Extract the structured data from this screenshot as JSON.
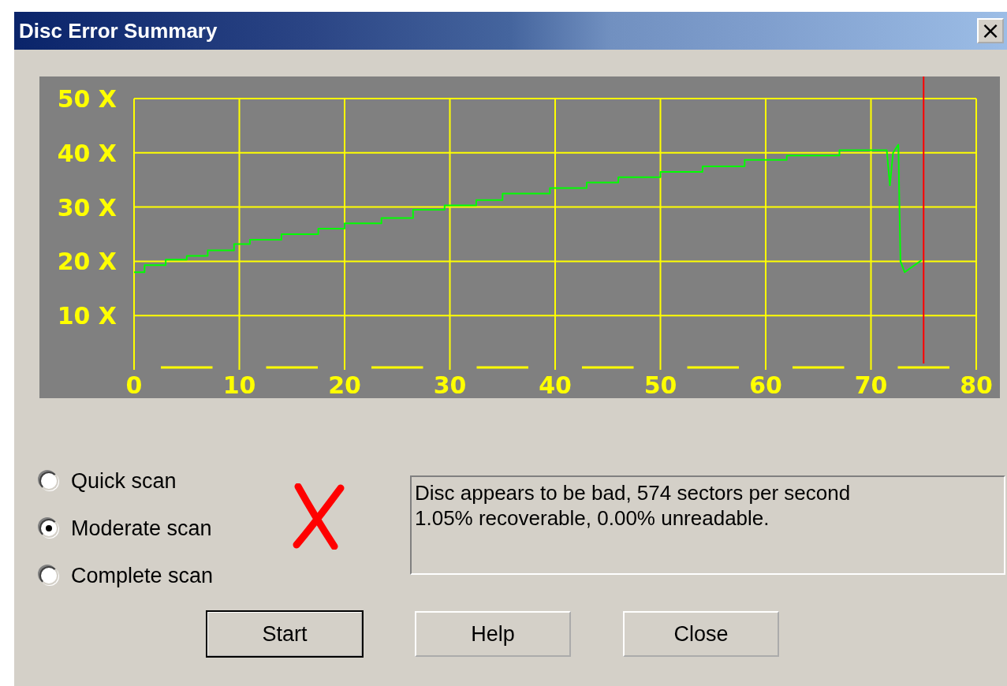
{
  "window": {
    "title": "Disc Error Summary",
    "close_label": "×"
  },
  "chart": {
    "chart_data": {
      "type": "line",
      "x": [
        0,
        1,
        1,
        3,
        3,
        5,
        5,
        7,
        7,
        9.5,
        9.5,
        11,
        11,
        14,
        14,
        17.5,
        17.5,
        20,
        20,
        23.5,
        23.5,
        26.5,
        26.5,
        29.5,
        29.5,
        32.5,
        32.5,
        35,
        35,
        39.5,
        39.5,
        43,
        43,
        46,
        46,
        50,
        50,
        54,
        54,
        58,
        58,
        62,
        62,
        67,
        67,
        71.5,
        71.8,
        72.1,
        72.6,
        72.8,
        73.2,
        74.8
      ],
      "grid": true,
      "series": [
        {
          "color": "#00ff00",
          "values": [
            18,
            18,
            19.3,
            19.3,
            20.3,
            20.3,
            21,
            21,
            22,
            22,
            23.2,
            23.2,
            24,
            24,
            25,
            25,
            26,
            26,
            27,
            27,
            28,
            28,
            29.5,
            29.5,
            30.3,
            30.3,
            31.3,
            31.3,
            32.5,
            32.5,
            33.5,
            33.5,
            34.5,
            34.5,
            35.5,
            35.5,
            36.5,
            36.5,
            37.5,
            37.5,
            38.7,
            38.7,
            39.5,
            39.5,
            40.5,
            40.5,
            34,
            40,
            41.5,
            20,
            18,
            20.2
          ]
        }
      ],
      "xlim": [
        0,
        80
      ],
      "ylim": [
        0,
        50
      ],
      "xticks": [
        0,
        10,
        20,
        30,
        40,
        50,
        60,
        70,
        80
      ],
      "yticks": [
        {
          "value": 10,
          "label": "10 X"
        },
        {
          "value": 20,
          "label": "20 X"
        },
        {
          "value": 30,
          "label": "30 X"
        },
        {
          "value": 40,
          "label": "40 X"
        },
        {
          "value": 50,
          "label": "50 X"
        }
      ],
      "ref_lines": [
        {
          "axis": "x",
          "value": 75,
          "color": "#ff0000"
        }
      ]
    }
  },
  "scan_options": [
    {
      "label": "Quick scan",
      "selected": false
    },
    {
      "label": "Moderate scan",
      "selected": true
    },
    {
      "label": "Complete scan",
      "selected": false
    }
  ],
  "status": {
    "kind": "error",
    "lines": [
      "Disc appears to be bad, 574 sectors per second",
      "1.05% recoverable, 0.00% unreadable."
    ]
  },
  "buttons": [
    {
      "label": "Start",
      "default": true
    },
    {
      "label": "Help",
      "default": false
    },
    {
      "label": "Close",
      "default": false
    }
  ]
}
